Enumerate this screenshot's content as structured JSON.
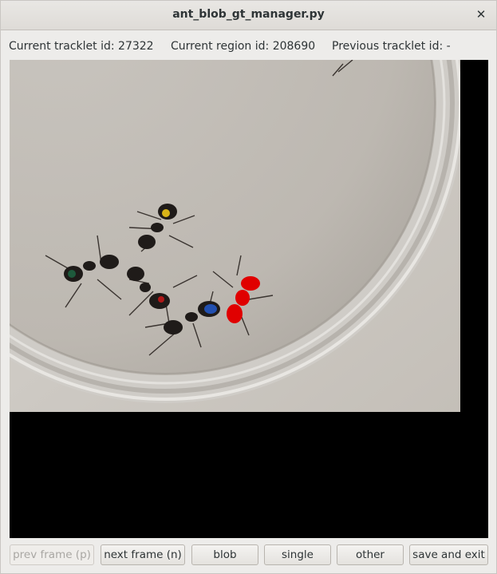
{
  "window": {
    "title": "ant_blob_gt_manager.py"
  },
  "info": {
    "current_tracklet": "Current tracklet id: 27322",
    "current_region": "Current region id: 208690",
    "previous_tracklet": "Previous tracklet id: -"
  },
  "buttons": {
    "prev_frame": "prev frame (p)",
    "next_frame": "next frame (n)",
    "blob": "blob",
    "single": "single",
    "other": "other",
    "save_exit": "save and exit"
  },
  "colors": {
    "highlight_blob": "#e00000",
    "marker_yellow": "#d8b418",
    "marker_green": "#1e5a3c",
    "marker_red": "#b01818",
    "marker_blue": "#2250b0"
  }
}
